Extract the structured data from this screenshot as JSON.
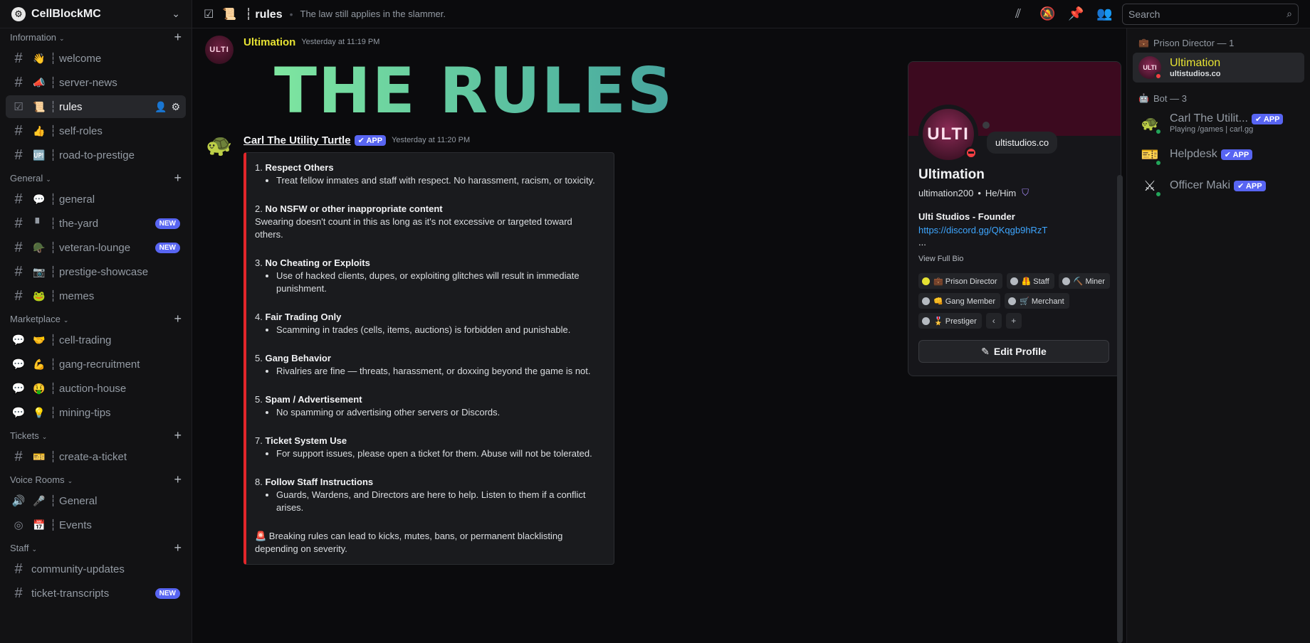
{
  "server": {
    "name": "CellBlockMC",
    "icon": "gear-icon"
  },
  "sidebar": {
    "categories": [
      {
        "label": "Information",
        "channels": [
          {
            "kind": "text",
            "emoji": "👋",
            "name": "welcome"
          },
          {
            "kind": "text",
            "emoji": "📣",
            "name": "server-news"
          },
          {
            "kind": "rules",
            "emoji": "📜",
            "name": "rules",
            "active": true
          },
          {
            "kind": "text",
            "emoji": "👍",
            "name": "self-roles"
          },
          {
            "kind": "text",
            "emoji": "🆙",
            "name": "road-to-prestige"
          }
        ]
      },
      {
        "label": "General",
        "channels": [
          {
            "kind": "text",
            "emoji": "💬",
            "name": "general"
          },
          {
            "kind": "text",
            "emoji": "▘",
            "name": "the-yard",
            "badge": "NEW"
          },
          {
            "kind": "text",
            "emoji": "🪖",
            "name": "veteran-lounge",
            "badge": "NEW"
          },
          {
            "kind": "text",
            "emoji": "📷",
            "name": "prestige-showcase"
          },
          {
            "kind": "text",
            "emoji": "🐸",
            "name": "memes"
          }
        ]
      },
      {
        "label": "Marketplace",
        "channels": [
          {
            "kind": "forum",
            "emoji": "🤝",
            "name": "cell-trading"
          },
          {
            "kind": "forum",
            "emoji": "💪",
            "name": "gang-recruitment"
          },
          {
            "kind": "forum",
            "emoji": "🤑",
            "name": "auction-house"
          },
          {
            "kind": "forum",
            "emoji": "💡",
            "name": "mining-tips"
          }
        ]
      },
      {
        "label": "Tickets",
        "channels": [
          {
            "kind": "text",
            "emoji": "🎫",
            "name": "create-a-ticket"
          }
        ]
      },
      {
        "label": "Voice Rooms",
        "channels": [
          {
            "kind": "voice",
            "emoji": "🎤",
            "name": "General"
          },
          {
            "kind": "stage",
            "emoji": "📅",
            "name": "Events"
          }
        ]
      },
      {
        "label": "Staff",
        "channels": [
          {
            "kind": "text",
            "emoji": "",
            "name": "community-updates"
          },
          {
            "kind": "text",
            "emoji": "",
            "name": "ticket-transcripts",
            "badge": "NEW"
          }
        ]
      }
    ]
  },
  "topbar": {
    "channel_emoji": "📜",
    "channel_name": "rules",
    "topic": "The law still applies in the slammer.",
    "search_placeholder": "Search"
  },
  "messages": {
    "first": {
      "author": "Ultimation",
      "timestamp": "Yesterday at 11:19 PM",
      "avatar_text": "ULTI",
      "big_title": "THE RULES"
    },
    "second": {
      "author": "Carl The Utility Turtle",
      "app_badge": "✔ APP",
      "timestamp": "Yesterday at 11:20 PM",
      "rules": [
        {
          "num": "1.",
          "title": "Respect Others",
          "bullets": [
            "Treat fellow inmates and staff with respect. No harassment, racism, or toxicity."
          ]
        },
        {
          "num": "2.",
          "title": "No NSFW or other inappropriate content",
          "plain": "Swearing doesn't count in this as long as it's not excessive or targeted toward others."
        },
        {
          "num": "3.",
          "title": "No Cheating or Exploits",
          "bullets": [
            "Use of hacked clients, dupes, or exploiting glitches will result in immediate punishment."
          ]
        },
        {
          "num": "4.",
          "title": "Fair Trading Only",
          "bullets": [
            "Scamming in trades (cells, items, auctions) is forbidden and punishable."
          ]
        },
        {
          "num": "5.",
          "title": "Gang Behavior",
          "bullets": [
            "Rivalries are fine — threats, harassment, or doxxing beyond the game is not."
          ]
        },
        {
          "num": "5.",
          "title": "Spam / Advertisement",
          "bullets": [
            "No spamming or advertising other servers or Discords."
          ]
        },
        {
          "num": "7.",
          "title": "Ticket System Use",
          "bullets": [
            "For support issues, please open a ticket for them. Abuse will not be tolerated."
          ]
        },
        {
          "num": "8.",
          "title": "Follow Staff Instructions",
          "bullets": [
            "Guards, Wardens, and Directors are here to help. Listen to them if a conflict arises."
          ]
        }
      ],
      "footer": "🚨 Breaking rules can lead to kicks, mutes, bans, or permanent blacklisting depending on severity."
    }
  },
  "profile": {
    "avatar_text": "ULTI",
    "status_text": "ultistudios.co",
    "display_name": "Ultimation",
    "username": "ultimation200",
    "pronouns": "He/Him",
    "bio_title": "Ulti Studios - Founder",
    "bio_link": "https://discord.gg/QKqgb9hRzT",
    "bio_more": "...",
    "view_bio": "View Full Bio",
    "roles": [
      {
        "label": "💼 Prison Director",
        "color": "yellow"
      },
      {
        "label": "🦺 Staff",
        "color": "gray"
      },
      {
        "label": "⛏️ Miner",
        "color": "gray"
      },
      {
        "label": "👊 Gang Member",
        "color": "gray"
      },
      {
        "label": "🛒 Merchant",
        "color": "gray"
      },
      {
        "label": "🎖️ Prestiger",
        "color": "gray"
      }
    ],
    "edit_label": "Edit Profile"
  },
  "members": {
    "groups": [
      {
        "label": "Prison Director — 1",
        "icon": "💼",
        "items": [
          {
            "name": "Ultimation",
            "sub": "ultistudios.co",
            "color": "yellow",
            "status": "dnd",
            "active": true,
            "avatar": "ULTI"
          }
        ]
      },
      {
        "label": "Bot — 3",
        "icon": "🤖",
        "items": [
          {
            "name": "Carl The Utilit...",
            "sub": "Playing /games | carl.gg",
            "badge": "✔ APP",
            "status": "online",
            "avatar": "🐢"
          },
          {
            "name": "Helpdesk",
            "badge": "✔ APP",
            "status": "online",
            "avatar": "🎫"
          },
          {
            "name": "Officer Maki",
            "badge": "✔ APP",
            "status": "online",
            "avatar": "⚔"
          }
        ]
      }
    ]
  }
}
